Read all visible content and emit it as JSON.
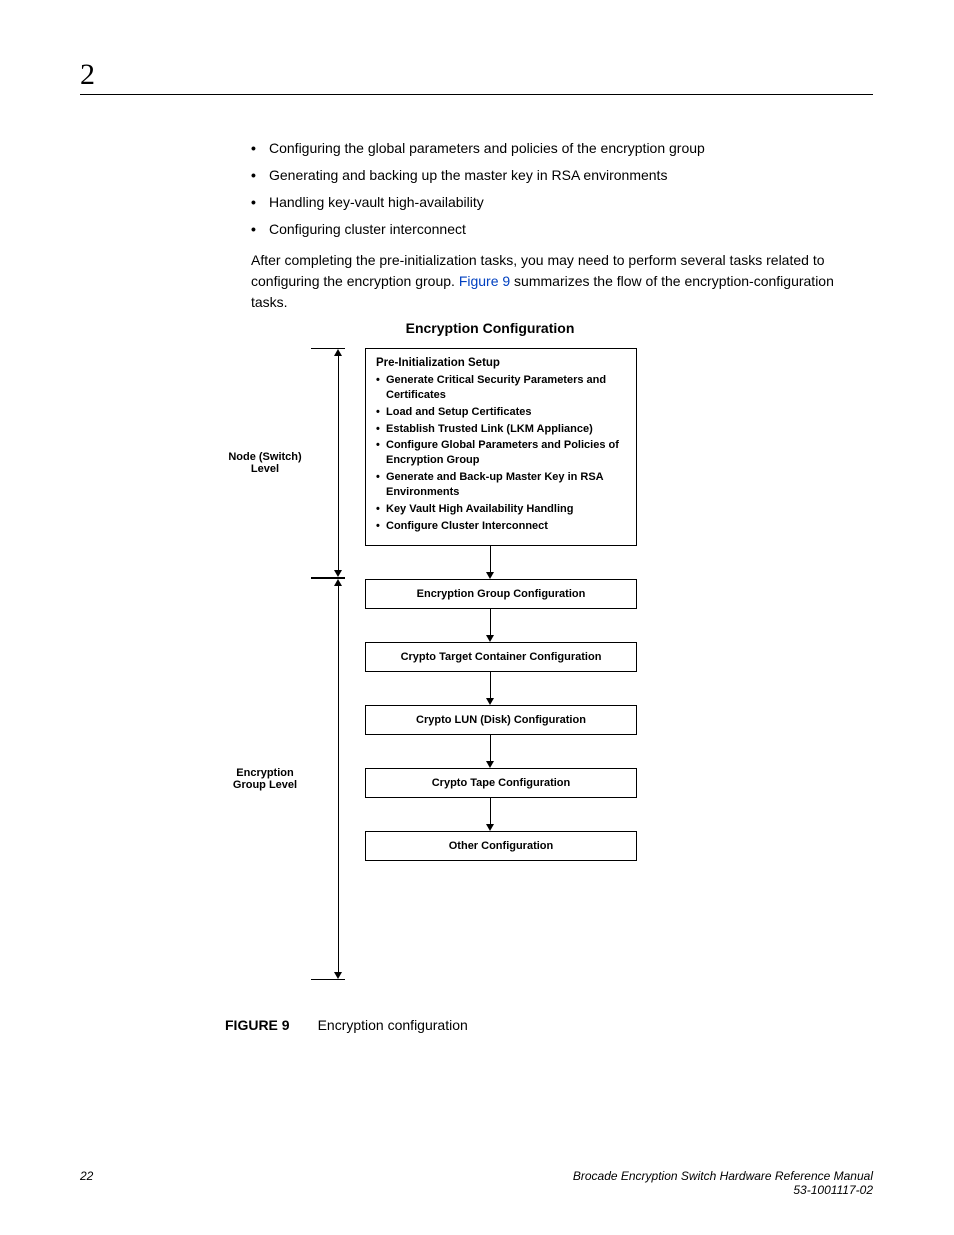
{
  "chapter_number": "2",
  "bullets": [
    "Configuring the global parameters and policies of the encryption group",
    "Generating and backing up the master key in RSA environments",
    "Handling key-vault high-availability",
    "Configuring cluster interconnect"
  ],
  "paragraph": {
    "part1": "After completing the pre-initialization tasks, you may need to perform several tasks related to configuring the encryption group. ",
    "link": "Figure 9",
    "part2": " summarizes the flow of the encryption-configuration tasks."
  },
  "diagram": {
    "title": "Encryption Configuration",
    "level1": "Node (Switch) Level",
    "level2": "Encryption Group Level",
    "preinit": {
      "heading": "Pre-Initialization Setup",
      "items": [
        "Generate Critical Security Parameters and Certificates",
        "Load and Setup Certificates",
        "Establish Trusted Link (LKM Appliance)",
        "Configure Global Parameters and Policies of Encryption Group",
        "Generate and Back-up Master Key in RSA Environments",
        "Key Vault High Availability Handling",
        "Configure Cluster Interconnect"
      ]
    },
    "boxes": [
      "Encryption Group Configuration",
      "Crypto Target Container Configuration",
      "Crypto LUN (Disk) Configuration",
      "Crypto Tape Configuration",
      "Other Configuration"
    ]
  },
  "figure_caption": {
    "label": "FIGURE 9",
    "text": "Encryption configuration"
  },
  "footer": {
    "page_number": "22",
    "manual_title": "Brocade Encryption Switch Hardware Reference Manual",
    "doc_number": "53-1001117-02"
  }
}
